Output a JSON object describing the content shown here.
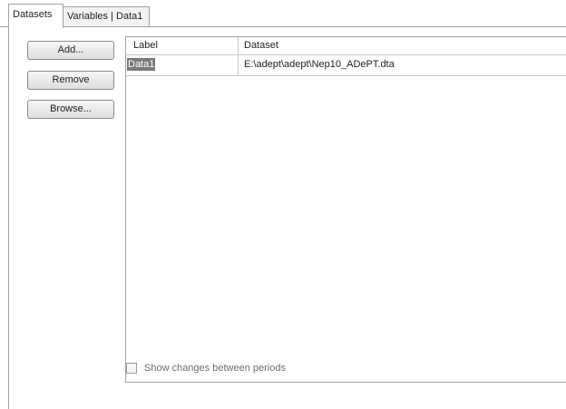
{
  "tabs": [
    {
      "label": "Datasets",
      "active": true
    },
    {
      "label": "Variables | Data1",
      "active": false
    }
  ],
  "buttons": {
    "add": "Add...",
    "remove": "Remove",
    "browse": "Browse..."
  },
  "grid": {
    "columns": [
      "Label",
      "Dataset"
    ],
    "rows": [
      {
        "label": "Data1",
        "dataset": "E:\\adept\\adept\\Nep10_ADePT.dta",
        "selected": true
      }
    ]
  },
  "option": {
    "show_changes_label": "Show changes between periods",
    "checked": false,
    "enabled": false
  }
}
